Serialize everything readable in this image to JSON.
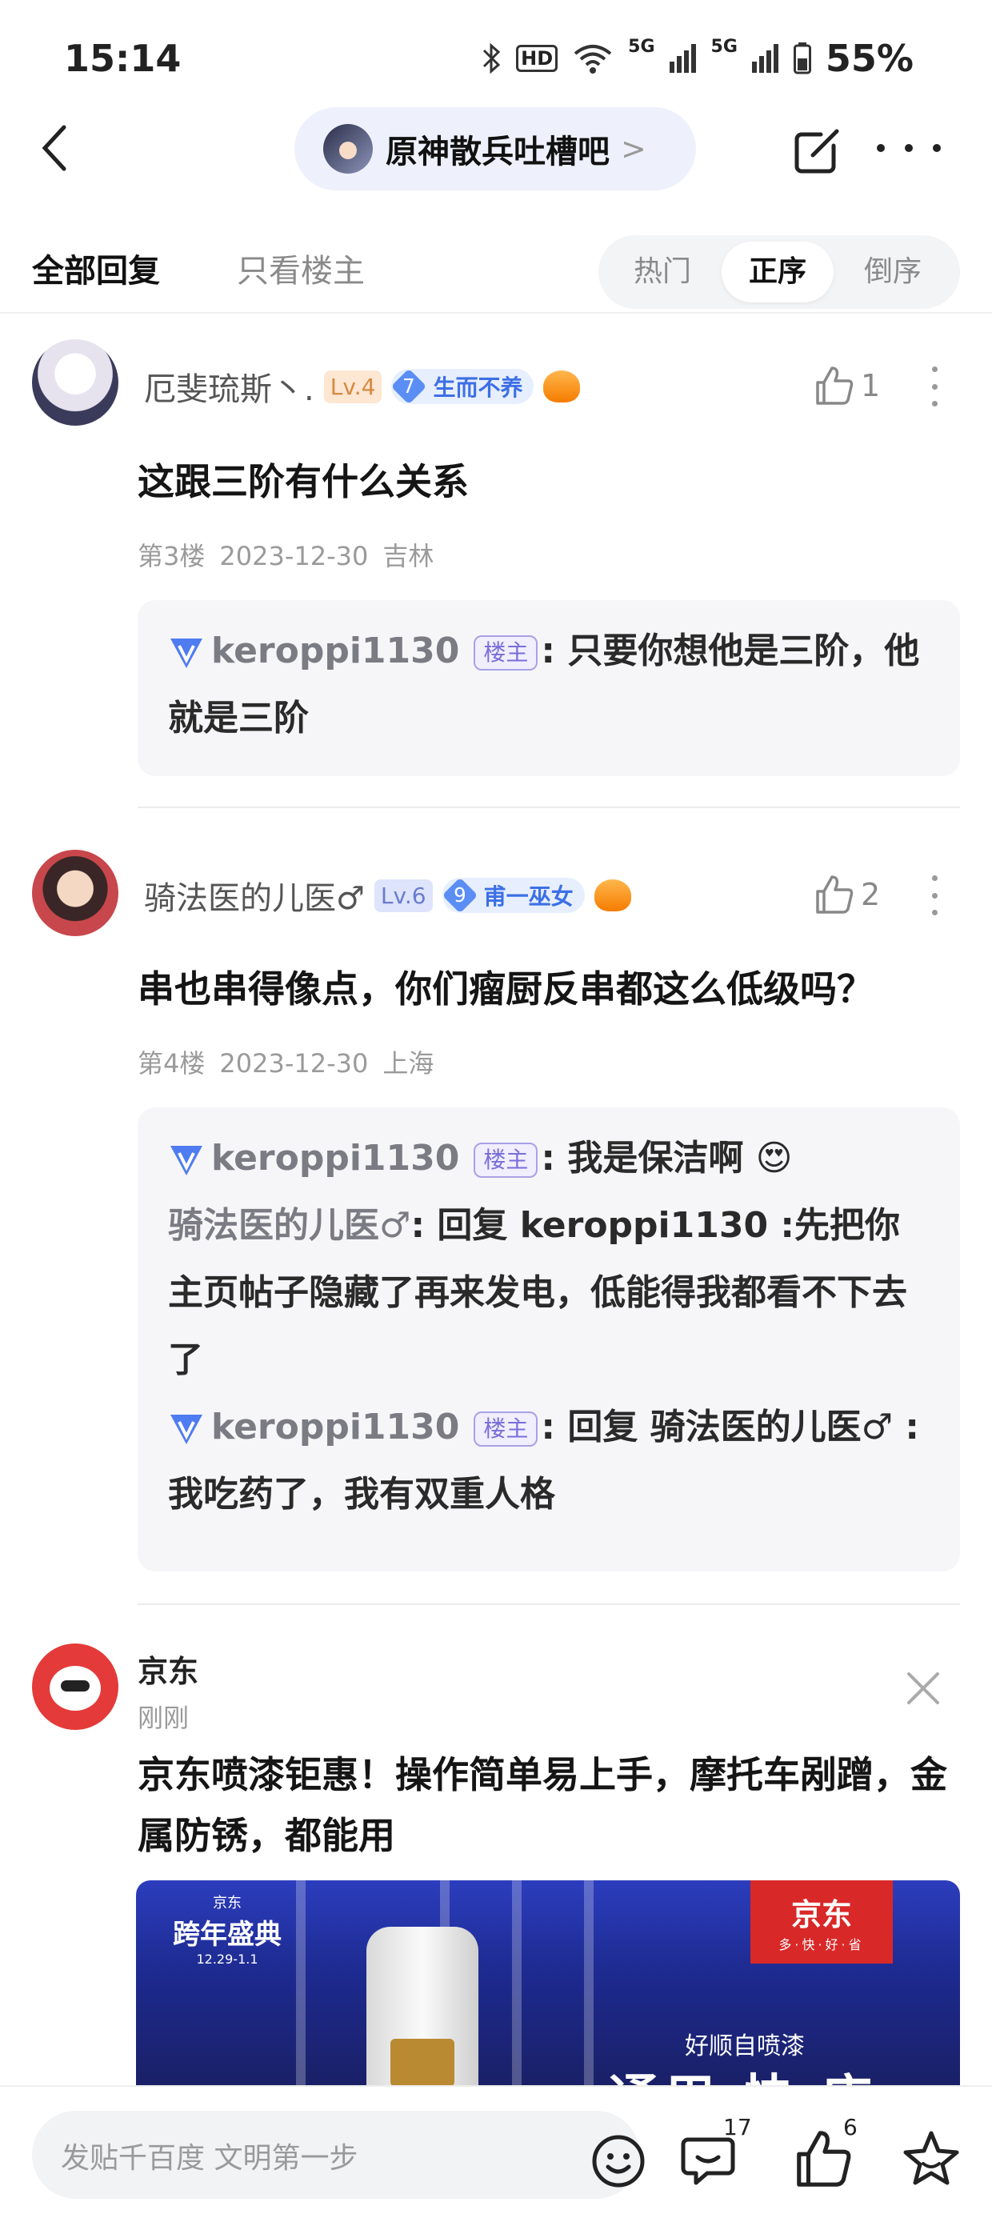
{
  "status_bar": {
    "time": "15:14",
    "hd": "HD",
    "net1": "5G",
    "net2": "5G",
    "battery": "55%"
  },
  "nav": {
    "forum_name": "原神散兵吐槽吧",
    "chevron": ">"
  },
  "filter": {
    "all_replies": "全部回复",
    "owner_only": "只看楼主",
    "sort_hot": "热门",
    "sort_asc": "正序",
    "sort_desc": "倒序"
  },
  "posts": [
    {
      "username": "厄斐琉斯丶.",
      "level": "Lv.4",
      "fan_level": "7",
      "fan_title": "生而不养",
      "likes": "1",
      "text": "这跟三阶有什么关系",
      "floor": "第3楼",
      "date": "2023-12-30",
      "location": "吉林",
      "replies": [
        {
          "author": "keroppi1130",
          "owner_tag": "楼主",
          "sep": ":",
          "content": " 只要你想他是三阶，他就是三阶"
        }
      ]
    },
    {
      "username": "骑法医的儿医♂",
      "level": "Lv.6",
      "fan_level": "9",
      "fan_title": "甫一巫女",
      "likes": "2",
      "text": "串也串得像点，你们瘤厨反串都这么低级吗？",
      "floor": "第4楼",
      "date": "2023-12-30",
      "location": "上海",
      "replies": [
        {
          "author": "keroppi1130",
          "owner_tag": "楼主",
          "sep": ":",
          "content": " 我是保洁啊 😍"
        },
        {
          "author": "骑法医的儿医♂",
          "sep": ":",
          "content": " 回复 keroppi1130 :先把你主页帖子隐藏了再来发电，低能得我都看不下去了"
        },
        {
          "author": "keroppi1130",
          "owner_tag": "楼主",
          "sep": ":",
          "content": " 回复 骑法医的儿医♂ :我吃药了，我有双重人格"
        }
      ]
    }
  ],
  "ad": {
    "name": "京东",
    "time": "刚刚",
    "text": "京东喷漆钜惠！操作简单易上手，摩托车剐蹭，金属防锈，都能用",
    "event_small": "京东",
    "event_big": "跨年盛典",
    "event_date": "12.29-1.1",
    "brand": "京东",
    "slogan": "多·快·好·省",
    "tag": "好顺自喷漆",
    "headline": "通用 快 店"
  },
  "bottom": {
    "placeholder": "发贴千百度 文明第一步",
    "comment_count": "17",
    "like_count": "6"
  }
}
